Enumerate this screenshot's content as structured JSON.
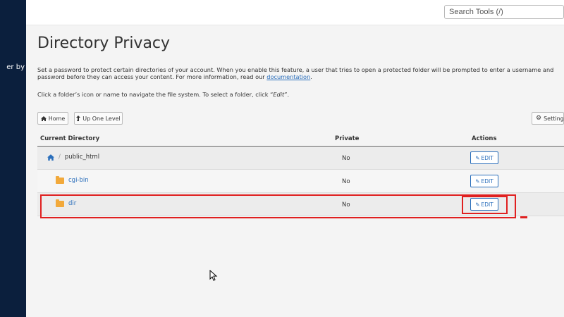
{
  "sidebar": {
    "fragment_text": "er by"
  },
  "topbar": {
    "search_placeholder": "Search Tools (/)"
  },
  "main": {
    "title": "Directory Privacy",
    "desc1_part1": "Set a password to protect certain directories of your account. When you enable this feature, a user that tries to open a protected folder will be prompted to enter a username and password before they can access your content. For more information, read our ",
    "desc1_link": "documentation",
    "desc1_part2": ".",
    "desc2_part1": "Click a folder’s icon or name to navigate the file system. To select a folder, click “",
    "desc2_em": "Edit",
    "desc2_part2": "”.",
    "home_label": "Home",
    "uplevel_label": "Up One Level",
    "settings_label": "Settings"
  },
  "table": {
    "headers": {
      "directory": "Current Directory",
      "private": "Private",
      "actions": "Actions"
    },
    "root": {
      "separator": "/",
      "name": "public_html",
      "private": "No",
      "action": "EDIT"
    },
    "rows": [
      {
        "name": "cgi-bin",
        "private": "No",
        "action": "EDIT"
      },
      {
        "name": "dir",
        "private": "No",
        "action": "EDIT"
      }
    ]
  },
  "colors": {
    "sidebar": "#0b1f3d",
    "link": "#2a6ebb",
    "folder": "#f2a93b",
    "highlight": "#e02020"
  }
}
